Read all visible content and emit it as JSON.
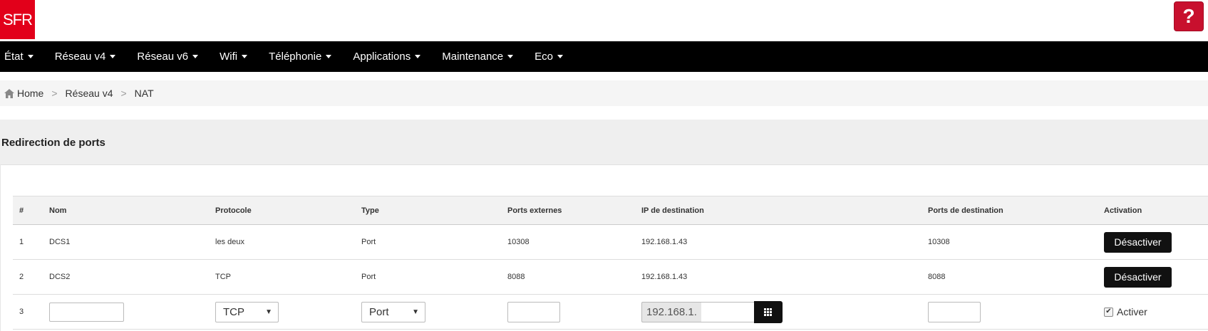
{
  "brand": {
    "logo_text": "SFR",
    "color": "#e2001a"
  },
  "help": {
    "label": "?"
  },
  "nav": {
    "items": [
      "État",
      "Réseau v4",
      "Réseau v6",
      "Wifi",
      "Téléphonie",
      "Applications",
      "Maintenance",
      "Eco"
    ]
  },
  "breadcrumb": {
    "home": "Home",
    "level1": "Réseau v4",
    "level2": "NAT",
    "separator": ">"
  },
  "section": {
    "title": "Redirection de ports"
  },
  "table": {
    "headers": [
      "#",
      "Nom",
      "Protocole",
      "Type",
      "Ports externes",
      "IP de destination",
      "Ports de destination",
      "Activation"
    ],
    "rows": [
      {
        "num": "1",
        "nom": "DCS1",
        "protocole": "les deux",
        "type": "Port",
        "ports_ext": "10308",
        "ip": "192.168.1.43",
        "ports_dest": "10308",
        "action": "Désactiver"
      },
      {
        "num": "2",
        "nom": "DCS2",
        "protocole": "TCP",
        "type": "Port",
        "ports_ext": "8088",
        "ip": "192.168.1.43",
        "ports_dest": "8088",
        "action": "Désactiver"
      }
    ],
    "new_row": {
      "num": "3",
      "protocole_selected": "TCP",
      "type_selected": "Port",
      "ip_prefix": "192.168.1.",
      "activate_label": "Activer",
      "activate_checked": true
    }
  }
}
